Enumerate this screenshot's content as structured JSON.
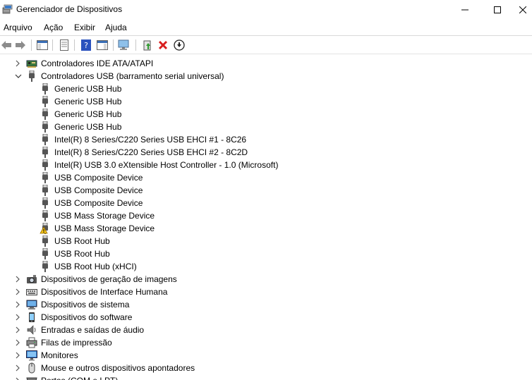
{
  "window": {
    "title": "Gerenciador de Dispositivos",
    "controls": [
      "minimize",
      "maximize",
      "close"
    ]
  },
  "menu": [
    "Arquivo",
    "Ação",
    "Exibir",
    "Ajuda"
  ],
  "toolbar": {
    "buttons": [
      "back-arrow-icon",
      "forward-arrow-icon",
      "console-tree-icon",
      "properties-icon",
      "help-icon",
      "action-pane-icon",
      "scan-hardware-icon",
      "update-driver-icon",
      "uninstall-icon",
      "disable-icon"
    ]
  },
  "tree": {
    "categories_before": [
      {
        "label": "Controladores IDE ATA/ATAPI",
        "expanded": false,
        "icon": "ide-controller-icon"
      }
    ],
    "usb": {
      "label": "Controladores USB (barramento serial universal)",
      "expanded": true,
      "icon": "usb-plug-icon",
      "children": [
        {
          "label": "Generic USB Hub",
          "warning": false
        },
        {
          "label": "Generic USB Hub",
          "warning": false
        },
        {
          "label": "Generic USB Hub",
          "warning": false
        },
        {
          "label": "Generic USB Hub",
          "warning": false
        },
        {
          "label": "Intel(R) 8 Series/C220 Series USB EHCI #1 - 8C26",
          "warning": false
        },
        {
          "label": "Intel(R) 8 Series/C220 Series USB EHCI #2 - 8C2D",
          "warning": false
        },
        {
          "label": "Intel(R) USB 3.0 eXtensible Host Controller - 1.0 (Microsoft)",
          "warning": false
        },
        {
          "label": "USB Composite Device",
          "warning": false
        },
        {
          "label": "USB Composite Device",
          "warning": false
        },
        {
          "label": "USB Composite Device",
          "warning": false
        },
        {
          "label": "USB Mass Storage Device",
          "warning": false
        },
        {
          "label": "USB Mass Storage Device",
          "warning": true
        },
        {
          "label": "USB Root Hub",
          "warning": false
        },
        {
          "label": "USB Root Hub",
          "warning": false
        },
        {
          "label": "USB Root Hub (xHCI)",
          "warning": false
        }
      ]
    },
    "categories_after": [
      {
        "label": "Dispositivos de geração de imagens",
        "expanded": false,
        "icon": "camera-icon"
      },
      {
        "label": "Dispositivos de Interface Humana",
        "expanded": false,
        "icon": "keyboard-icon"
      },
      {
        "label": "Dispositivos de sistema",
        "expanded": false,
        "icon": "system-device-icon"
      },
      {
        "label": "Dispositivos do software",
        "expanded": false,
        "icon": "software-device-icon"
      },
      {
        "label": "Entradas e saídas de áudio",
        "expanded": false,
        "icon": "speaker-icon"
      },
      {
        "label": "Filas de impressão",
        "expanded": false,
        "icon": "printer-icon"
      },
      {
        "label": "Monitores",
        "expanded": false,
        "icon": "monitor-icon"
      },
      {
        "label": "Mouse e outros dispositivos apontadores",
        "expanded": false,
        "icon": "mouse-icon"
      },
      {
        "label": "Portas (COM e LPT)",
        "expanded": false,
        "icon": "port-icon"
      }
    ]
  }
}
